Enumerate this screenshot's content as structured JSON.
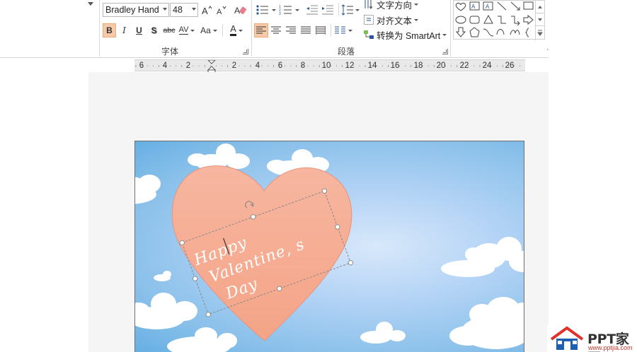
{
  "ribbon": {
    "font": {
      "name": "Bradley Hand",
      "size": "48",
      "group_label": "字体",
      "bold": "B",
      "italic": "I",
      "underline": "U",
      "shadow": "S",
      "strike": "abc",
      "spacing": "AV",
      "case": "Aa",
      "color": "A"
    },
    "paragraph": {
      "group_label": "段落",
      "text_direction": "文字方向",
      "align_text": "对齐文本",
      "smartart": "转换为 SmartArt",
      "selected_alignment": "align-left"
    },
    "shapes_gallery": {
      "row1": [
        "heart",
        "text-box",
        "vertical-text-box",
        "line",
        "line-arrow",
        "rectangle"
      ],
      "row2": [
        "oval",
        "rounded-rectangle",
        "triangle",
        "elbow-connector",
        "elbow-arrow-connector",
        "right-arrow"
      ],
      "row3": [
        "down-arrow",
        "pentagon",
        "curved-connector",
        "curved-connector-2",
        "freeform",
        "left-brace"
      ]
    }
  },
  "ruler": {
    "labels": [
      "6",
      "4",
      "2",
      "2",
      "4",
      "6",
      "8",
      "10",
      "12",
      "14",
      "16",
      "18",
      "20",
      "22",
      "24",
      "26"
    ]
  },
  "slide": {
    "heart_text_lines": [
      "Happy",
      "Valentine, s",
      "Day"
    ],
    "colors": {
      "heart": "#f5ac8f",
      "sky": "#89c0ea",
      "cloud": "#ffffff"
    }
  },
  "watermark": {
    "brand": "PPT家园",
    "url": "www.pptjia.com"
  }
}
